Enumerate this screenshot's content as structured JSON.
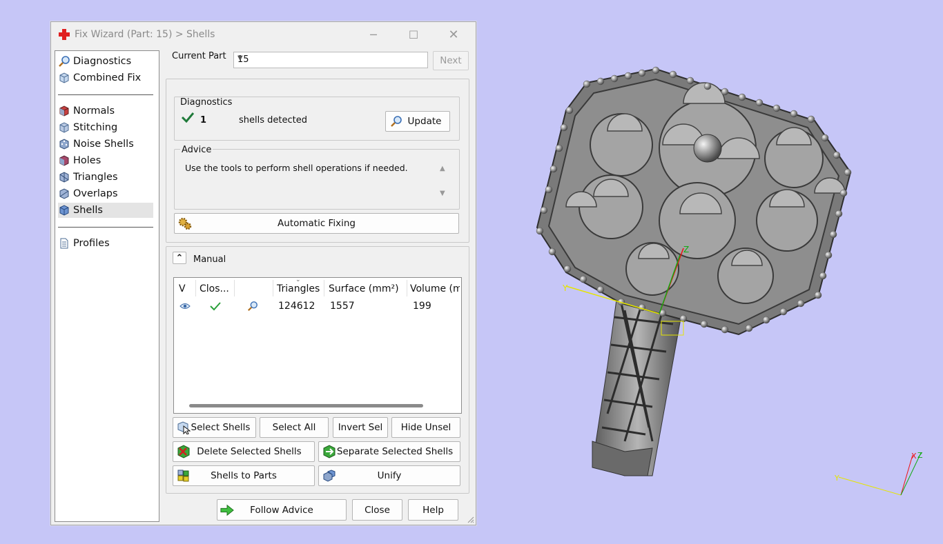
{
  "window": {
    "title": "Fix Wizard (Part: 15) > Shells",
    "minimize_glyph": "─",
    "maximize_glyph": "☐",
    "close_glyph": "✕"
  },
  "sidebar": {
    "items": [
      {
        "label": "Diagnostics",
        "icon": "magnifier-icon"
      },
      {
        "label": "Combined Fix",
        "icon": "cube-icon"
      },
      {
        "label": "Normals",
        "icon": "cube-red-icon"
      },
      {
        "label": "Stitching",
        "icon": "cube-stitch-icon"
      },
      {
        "label": "Noise Shells",
        "icon": "cube-noise-icon"
      },
      {
        "label": "Holes",
        "icon": "cube-holes-icon"
      },
      {
        "label": "Triangles",
        "icon": "cube-triangles-icon"
      },
      {
        "label": "Overlaps",
        "icon": "cube-overlaps-icon"
      },
      {
        "label": "Shells",
        "icon": "cube-shells-icon"
      },
      {
        "label": "Profiles",
        "icon": "document-icon"
      }
    ],
    "active": "Shells"
  },
  "current_part": {
    "label": "Current Part",
    "value": "15",
    "next_label": "Next"
  },
  "diagnostics": {
    "legend": "Diagnostics",
    "count": "1",
    "text": "shells detected",
    "update_label": "Update"
  },
  "advice": {
    "legend": "Advice",
    "text": "Use the tools to perform shell operations if needed.",
    "automatic_fixing_label": "Automatic Fixing"
  },
  "manual": {
    "label": "Manual",
    "collapse_glyph": "⌃",
    "columns": [
      "V",
      "Clos...",
      "",
      "Triangles",
      "Surface (mm²)",
      "Volume (m"
    ],
    "rows": [
      {
        "triangles": "124612",
        "surface": "1557",
        "volume": "199"
      }
    ],
    "buttons": {
      "select_shells": "Select Shells",
      "select_all": "Select All",
      "invert_sel": "Invert Sel",
      "hide_unsel": "Hide Unsel",
      "delete_selected": "Delete Selected Shells",
      "separate_selected": "Separate Selected Shells",
      "shells_to_parts": "Shells to Parts",
      "unify": "Unify"
    }
  },
  "footer": {
    "follow_advice": "Follow Advice",
    "close": "Close",
    "help": "Help"
  },
  "viewport": {
    "axis_x": "X",
    "axis_y": "Y",
    "axis_z": "Z",
    "background": "#c6c6f7"
  }
}
